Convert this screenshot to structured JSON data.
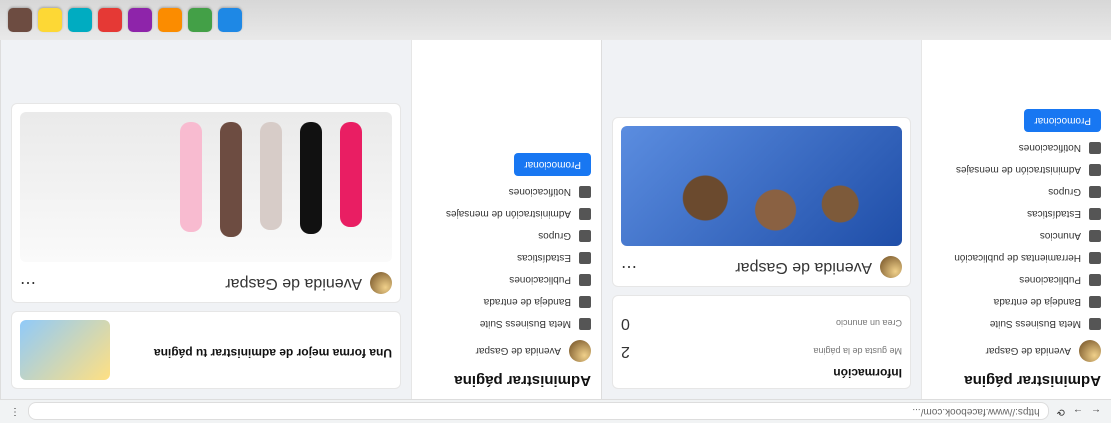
{
  "browser": {
    "url_a": "https://www.facebook.com/...",
    "url_b": "https://www.facebook.com/..."
  },
  "screen_a": {
    "title": "Administrar página",
    "page_name": "Avenida de Gaspar",
    "nav": [
      {
        "label": "Meta Business Suite",
        "icon": "grid-icon"
      },
      {
        "label": "Bandeja de entrada",
        "icon": "inbox-icon"
      },
      {
        "label": "Publicaciones",
        "icon": "post-icon"
      },
      {
        "label": "Herramientas de publicación",
        "icon": "tools-icon"
      },
      {
        "label": "Anuncios",
        "icon": "megaphone-icon"
      },
      {
        "label": "Estadísticas",
        "icon": "chart-icon"
      },
      {
        "label": "Grupos",
        "icon": "groups-icon"
      },
      {
        "label": "Administración de mensajes",
        "icon": "messages-icon"
      },
      {
        "label": "Notificaciones",
        "icon": "bell-icon"
      }
    ],
    "cta": "Promocionar",
    "info_title": "Información",
    "stat_label_1": "Me gusta de la página",
    "stat_value_1": "2",
    "stat_label_2": "Crea un anuncio",
    "stat_value_2": "0"
  },
  "screen_b": {
    "title": "Administrar página",
    "page_name": "Avenida de Gaspar",
    "nav": [
      {
        "label": "Meta Business Suite",
        "icon": "grid-icon"
      },
      {
        "label": "Bandeja de entrada",
        "icon": "inbox-icon"
      },
      {
        "label": "Publicaciones",
        "icon": "post-icon"
      },
      {
        "label": "Estadísticas",
        "icon": "chart-icon"
      },
      {
        "label": "Grupos",
        "icon": "groups-icon"
      },
      {
        "label": "Administración de mensajes",
        "icon": "messages-icon"
      },
      {
        "label": "Notificaciones",
        "icon": "bell-icon"
      }
    ],
    "promo_title": "Una forma mejor de administrar tu página",
    "cta": "Promocionar"
  },
  "taskbar": {
    "apps": [
      "#1e88e5",
      "#43a047",
      "#fb8c00",
      "#8e24aa",
      "#e53935",
      "#00acc1",
      "#fdd835",
      "#6d4c41"
    ]
  },
  "colors": {
    "brand_blue": "#1877f2"
  }
}
